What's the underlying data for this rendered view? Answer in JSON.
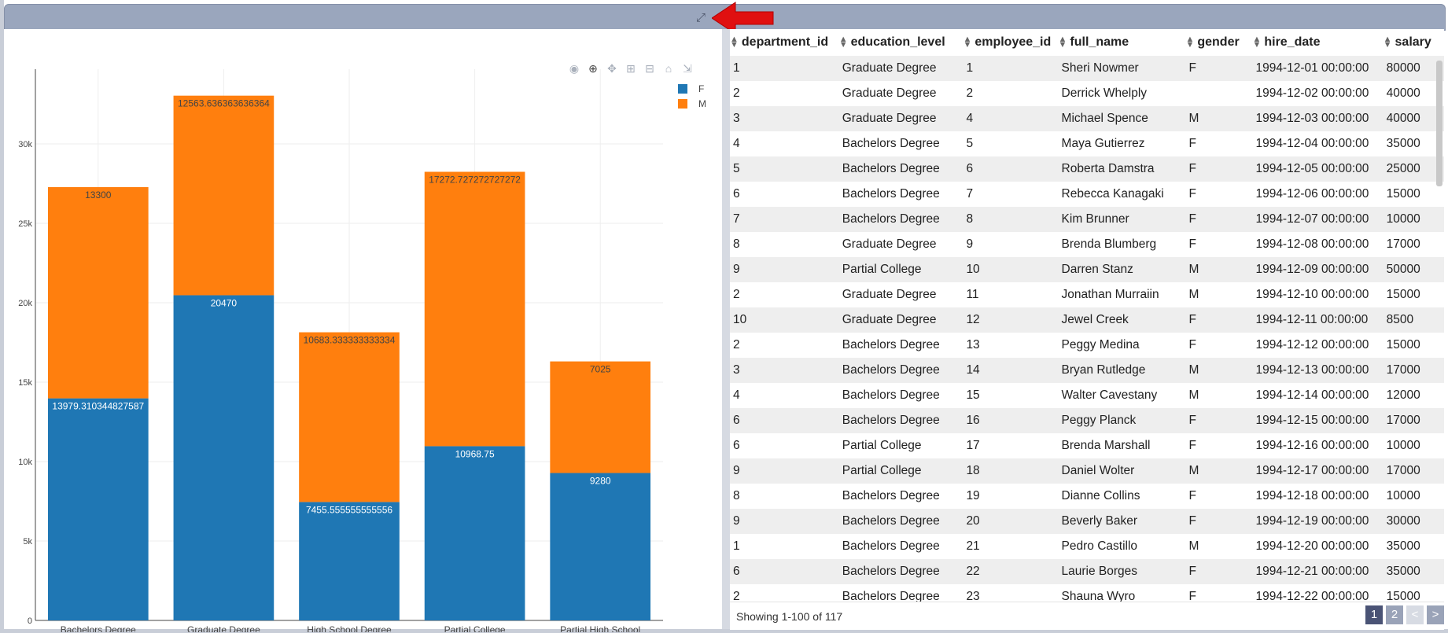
{
  "toolbar": {
    "expand_icon": "expand-icon",
    "expand_glyph": "⤢"
  },
  "modebar": {
    "buttons": [
      {
        "name": "camera-icon",
        "glyph": "◉"
      },
      {
        "name": "zoom-icon",
        "glyph": "⊕"
      },
      {
        "name": "pan-icon",
        "glyph": "✥"
      },
      {
        "name": "zoom-in-icon",
        "glyph": "⊞"
      },
      {
        "name": "zoom-out-icon",
        "glyph": "⊟"
      },
      {
        "name": "home-icon",
        "glyph": "⌂"
      },
      {
        "name": "autoscale-icon",
        "glyph": "⇲"
      }
    ]
  },
  "chart_data": {
    "type": "bar",
    "barmode": "stack",
    "categories": [
      "Bachelors Degree",
      "Graduate Degree",
      "High School Degree",
      "Partial College",
      "Partial High School"
    ],
    "series": [
      {
        "name": "F",
        "color": "#1f77b4",
        "values": [
          13979.310344827587,
          20470,
          7455.555555555556,
          10968.75,
          9280
        ],
        "labels": [
          "13979.310344827587",
          "20470",
          "7455.555555555556",
          "10968.75",
          "9280"
        ]
      },
      {
        "name": "M",
        "color": "#ff7f0e",
        "values": [
          13300,
          12563.636363636364,
          10683.333333333334,
          17272.727272727272,
          7025
        ],
        "labels": [
          "13300",
          "12563.636363636364",
          "10683.333333333334",
          "17272.727272727272",
          "7025"
        ]
      }
    ],
    "yticks": [
      0,
      5000,
      10000,
      15000,
      20000,
      25000,
      30000
    ],
    "ytick_labels": [
      "0",
      "5k",
      "10k",
      "15k",
      "20k",
      "25k",
      "30k"
    ],
    "ylim": [
      0,
      34700
    ],
    "grid": true,
    "legend_position": "top-right"
  },
  "table": {
    "columns": [
      "department_id",
      "education_level",
      "employee_id",
      "full_name",
      "gender",
      "hire_date",
      "salary"
    ],
    "rows": [
      [
        "1",
        "Graduate Degree",
        "1",
        "Sheri Nowmer",
        "F",
        "1994-12-01 00:00:00",
        "80000"
      ],
      [
        "2",
        "Graduate Degree",
        "2",
        "Derrick Whelply",
        "",
        "1994-12-02 00:00:00",
        "40000"
      ],
      [
        "3",
        "Graduate Degree",
        "4",
        "Michael Spence",
        "M",
        "1994-12-03 00:00:00",
        "40000"
      ],
      [
        "4",
        "Bachelors Degree",
        "5",
        "Maya Gutierrez",
        "F",
        "1994-12-04 00:00:00",
        "35000"
      ],
      [
        "5",
        "Bachelors Degree",
        "6",
        "Roberta Damstra",
        "F",
        "1994-12-05 00:00:00",
        "25000"
      ],
      [
        "6",
        "Bachelors Degree",
        "7",
        "Rebecca Kanagaki",
        "F",
        "1994-12-06 00:00:00",
        "15000"
      ],
      [
        "7",
        "Bachelors Degree",
        "8",
        "Kim Brunner",
        "F",
        "1994-12-07 00:00:00",
        "10000"
      ],
      [
        "8",
        "Graduate Degree",
        "9",
        "Brenda Blumberg",
        "F",
        "1994-12-08 00:00:00",
        "17000"
      ],
      [
        "9",
        "Partial College",
        "10",
        "Darren Stanz",
        "M",
        "1994-12-09 00:00:00",
        "50000"
      ],
      [
        "2",
        "Graduate Degree",
        "11",
        "Jonathan Murraiin",
        "M",
        "1994-12-10 00:00:00",
        "15000"
      ],
      [
        "10",
        "Graduate Degree",
        "12",
        "Jewel Creek",
        "F",
        "1994-12-11 00:00:00",
        "8500"
      ],
      [
        "2",
        "Bachelors Degree",
        "13",
        "Peggy Medina",
        "F",
        "1994-12-12 00:00:00",
        "15000"
      ],
      [
        "3",
        "Bachelors Degree",
        "14",
        "Bryan Rutledge",
        "M",
        "1994-12-13 00:00:00",
        "17000"
      ],
      [
        "4",
        "Bachelors Degree",
        "15",
        "Walter Cavestany",
        "M",
        "1994-12-14 00:00:00",
        "12000"
      ],
      [
        "6",
        "Bachelors Degree",
        "16",
        "Peggy Planck",
        "F",
        "1994-12-15 00:00:00",
        "17000"
      ],
      [
        "6",
        "Partial College",
        "17",
        "Brenda Marshall",
        "F",
        "1994-12-16 00:00:00",
        "10000"
      ],
      [
        "9",
        "Partial College",
        "18",
        "Daniel Wolter",
        "M",
        "1994-12-17 00:00:00",
        "17000"
      ],
      [
        "8",
        "Bachelors Degree",
        "19",
        "Dianne Collins",
        "F",
        "1994-12-18 00:00:00",
        "10000"
      ],
      [
        "9",
        "Bachelors Degree",
        "20",
        "Beverly Baker",
        "F",
        "1994-12-19 00:00:00",
        "30000"
      ],
      [
        "1",
        "Bachelors Degree",
        "21",
        "Pedro Castillo",
        "M",
        "1994-12-20 00:00:00",
        "35000"
      ],
      [
        "6",
        "Bachelors Degree",
        "22",
        "Laurie Borges",
        "F",
        "1994-12-21 00:00:00",
        "35000"
      ],
      [
        "2",
        "Bachelors Degree",
        "23",
        "Shauna Wyro",
        "F",
        "1994-12-22 00:00:00",
        "15000"
      ]
    ]
  },
  "footer": {
    "status": "Showing 1-100 of 117"
  },
  "pager": {
    "page1": "1",
    "page2": "2",
    "prev": "<",
    "next": ">"
  }
}
